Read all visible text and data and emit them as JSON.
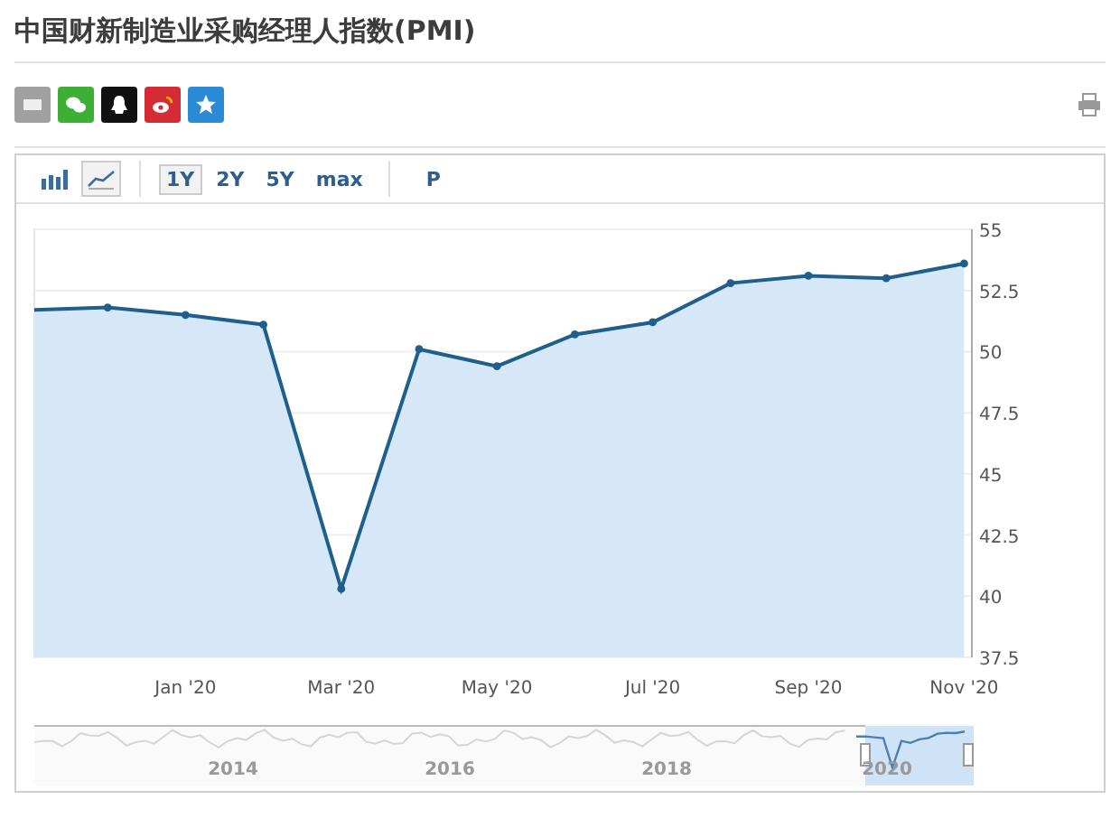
{
  "title": "中国财新制造业采购经理人指数(PMI)",
  "share_icons": [
    {
      "kind": "email",
      "color": "#a0a0a0"
    },
    {
      "kind": "wechat",
      "color": "#3cb034"
    },
    {
      "kind": "qq",
      "color": "#111111"
    },
    {
      "kind": "weibo",
      "color": "#d52b35"
    },
    {
      "kind": "qzone",
      "color": "#2a8ad4"
    }
  ],
  "toolbar": {
    "chart_types": [
      {
        "kind": "bar",
        "selected": false
      },
      {
        "kind": "line",
        "selected": true
      }
    ],
    "ranges": [
      {
        "label": "1Y",
        "selected": true
      },
      {
        "label": "2Y",
        "selected": false
      },
      {
        "label": "5Y",
        "selected": false
      },
      {
        "label": "max",
        "selected": false
      }
    ],
    "extra": "P"
  },
  "chart": {
    "chart_data": {
      "type": "area",
      "categories": [
        null,
        null,
        "Jan '20",
        null,
        "Mar '20",
        null,
        "May '20",
        null,
        "Jul '20",
        null,
        "Sep '20",
        null,
        "Nov '20"
      ],
      "series": [
        {
          "color": "#1f5f8b",
          "values": [
            51.7,
            51.8,
            51.5,
            51.1,
            40.3,
            50.1,
            49.4,
            50.7,
            51.2,
            52.8,
            53.1,
            53.0,
            53.6
          ]
        }
      ],
      "ylim": [
        37.5,
        55
      ],
      "yticks": [
        37.5,
        40,
        42.5,
        45,
        47.5,
        50,
        52.5,
        55
      ],
      "grid": true
    }
  },
  "navigator": {
    "years": [
      "2014",
      "2016",
      "2018",
      "2020"
    ]
  }
}
